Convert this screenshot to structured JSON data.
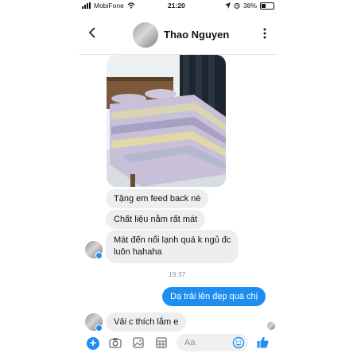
{
  "status_bar": {
    "carrier": "MobiFone",
    "time": "21:20",
    "battery": "38%"
  },
  "header": {
    "contact_name": "Thao Nguyen"
  },
  "messages": [
    {
      "text": "Tặng em feed back nè",
      "from": "contact"
    },
    {
      "text": "Chất liệu nằm rất mát",
      "from": "contact"
    },
    {
      "text_line1": "Mát đến nổi lạnh quá k ngủ đc",
      "text_line2": "luôn hahaha",
      "from": "contact"
    },
    {
      "text": "Dạ trải lên đẹp quá chị",
      "from": "me"
    },
    {
      "text": "Vải c thích lắm e",
      "from": "contact"
    }
  ],
  "timestamp": "19:37",
  "composer": {
    "placeholder": "Aa"
  },
  "colors": {
    "accent": "#1f8ef1",
    "incoming_bubble": "#eeeef0",
    "outgoing_bubble": "#1f8ef1"
  },
  "icons": [
    "back-arrow-icon",
    "more-vertical-icon",
    "plus-icon",
    "camera-icon",
    "gallery-icon",
    "sticker-grid-icon",
    "emoji-icon",
    "thumbs-up-icon",
    "wifi-icon",
    "location-icon",
    "alarm-icon"
  ]
}
